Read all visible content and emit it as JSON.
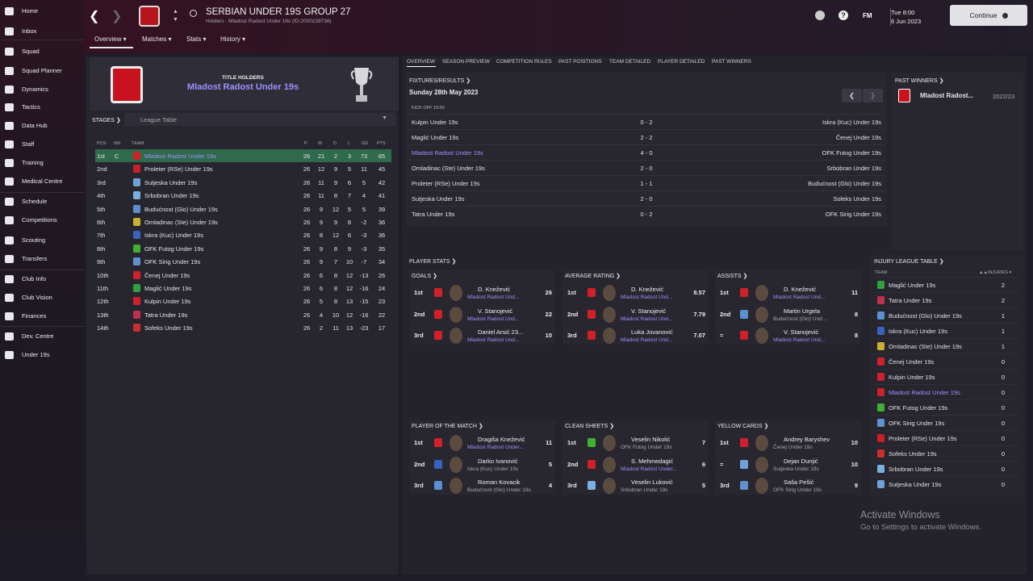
{
  "sidebar": [
    {
      "label": "Home",
      "icon": "home-icon"
    },
    {
      "label": "Inbox",
      "icon": "inbox-icon"
    },
    {
      "label": "Squad",
      "icon": "squad-icon"
    },
    {
      "label": "Squad Planner",
      "icon": "squad-planner-icon"
    },
    {
      "label": "Dynamics",
      "icon": "dynamics-icon"
    },
    {
      "label": "Tactics",
      "icon": "tactics-icon"
    },
    {
      "label": "Data Hub",
      "icon": "data-hub-icon"
    },
    {
      "label": "Staff",
      "icon": "staff-icon"
    },
    {
      "label": "Training",
      "icon": "training-icon"
    },
    {
      "label": "Medical Centre",
      "icon": "medical-icon"
    },
    {
      "label": "Schedule",
      "icon": "schedule-icon"
    },
    {
      "label": "Competitions",
      "icon": "competitions-icon"
    },
    {
      "label": "Scouting",
      "icon": "scouting-icon"
    },
    {
      "label": "Transfers",
      "icon": "transfers-icon"
    },
    {
      "label": "Club Info",
      "icon": "club-info-icon"
    },
    {
      "label": "Club Vision",
      "icon": "club-vision-icon"
    },
    {
      "label": "Finances",
      "icon": "finances-icon"
    },
    {
      "label": "Dev. Centre",
      "icon": "dev-centre-icon"
    },
    {
      "label": "Under 19s",
      "icon": "under-19s-icon"
    }
  ],
  "header": {
    "title": "SERBIAN UNDER 19S GROUP 27",
    "subtitle": "Holders - Mladost Radost Under 19s (ID:2000239736)",
    "date_day": "Tue 8:00",
    "date": "6 Jun 2023",
    "fm": "FM",
    "continue": "Continue"
  },
  "subtabs": [
    "Overview",
    "Matches",
    "Stats",
    "History"
  ],
  "holder": {
    "label": "TITLE HOLDERS",
    "name": "Mladost Radost Under 19s"
  },
  "stages": {
    "label": "STAGES",
    "value": "League Table"
  },
  "table_head": {
    "pos": "POS",
    "inf": "INF",
    "team": "TEAM",
    "p": "P",
    "w": "W",
    "d": "D",
    "l": "L",
    "gd": "GD",
    "pts": "PTS"
  },
  "league": [
    {
      "pos": "1st",
      "inf": "C",
      "team": "Mladost Radost Under 19s",
      "p": "26",
      "w": "21",
      "d": "2",
      "l": "3",
      "gd": "73",
      "pts": "65",
      "color": "#d0202a"
    },
    {
      "pos": "2nd",
      "inf": "",
      "team": "Proleter (RSe) Under 19s",
      "p": "26",
      "w": "12",
      "d": "9",
      "l": "5",
      "gd": "11",
      "pts": "45",
      "color": "#c8202a"
    },
    {
      "pos": "3rd",
      "inf": "",
      "team": "Sutjeska Under 19s",
      "p": "26",
      "w": "11",
      "d": "9",
      "l": "6",
      "gd": "5",
      "pts": "42",
      "color": "#6fa0d8"
    },
    {
      "pos": "4th",
      "inf": "",
      "team": "Srbobran Under 19s",
      "p": "26",
      "w": "11",
      "d": "8",
      "l": "7",
      "gd": "4",
      "pts": "41",
      "color": "#7ab0e0"
    },
    {
      "pos": "5th",
      "inf": "",
      "team": "Budućnost (Glo) Under 19s",
      "p": "26",
      "w": "9",
      "d": "12",
      "l": "5",
      "gd": "5",
      "pts": "39",
      "color": "#5a90d0"
    },
    {
      "pos": "6th",
      "inf": "",
      "team": "Omladinac (Ste) Under 19s",
      "p": "26",
      "w": "9",
      "d": "9",
      "l": "8",
      "gd": "-2",
      "pts": "36",
      "color": "#c8b030"
    },
    {
      "pos": "7th",
      "inf": "",
      "team": "Iskra (Kuc) Under 19s",
      "p": "26",
      "w": "8",
      "d": "12",
      "l": "6",
      "gd": "-3",
      "pts": "36",
      "color": "#3a60c0"
    },
    {
      "pos": "8th",
      "inf": "",
      "team": "OFK Futog Under 19s",
      "p": "26",
      "w": "9",
      "d": "8",
      "l": "9",
      "gd": "-3",
      "pts": "35",
      "color": "#40b030"
    },
    {
      "pos": "9th",
      "inf": "",
      "team": "OFK Sirig Under 19s",
      "p": "26",
      "w": "9",
      "d": "7",
      "l": "10",
      "gd": "-7",
      "pts": "34",
      "color": "#6090d0"
    },
    {
      "pos": "10th",
      "inf": "",
      "team": "Čenej Under 19s",
      "p": "26",
      "w": "6",
      "d": "8",
      "l": "12",
      "gd": "-13",
      "pts": "26",
      "color": "#d02030"
    },
    {
      "pos": "11th",
      "inf": "",
      "team": "Maglić Under 19s",
      "p": "26",
      "w": "6",
      "d": "8",
      "l": "12",
      "gd": "-16",
      "pts": "24",
      "color": "#30a040"
    },
    {
      "pos": "12th",
      "inf": "",
      "team": "Kulpin Under 19s",
      "p": "26",
      "w": "5",
      "d": "8",
      "l": "13",
      "gd": "-15",
      "pts": "23",
      "color": "#d02030"
    },
    {
      "pos": "13th",
      "inf": "",
      "team": "Tatra Under 19s",
      "p": "26",
      "w": "4",
      "d": "10",
      "l": "12",
      "gd": "-16",
      "pts": "22",
      "color": "#c03050"
    },
    {
      "pos": "14th",
      "inf": "",
      "team": "Sofeks Under 19s",
      "p": "26",
      "w": "2",
      "d": "11",
      "l": "13",
      "gd": "-23",
      "pts": "17",
      "color": "#c83030"
    }
  ],
  "right_tabs": [
    "OVERVIEW",
    "SEASON PREVIEW",
    "COMPETITION RULES",
    "PAST POSITIONS",
    "TEAM DETAILED",
    "PLAYER DETAILED",
    "PAST WINNERS"
  ],
  "fixtures": {
    "label": "FIXTURES/RESULTS",
    "date": "Sunday 28th May 2023",
    "kickoff": "KICK OFF 15:00",
    "rows": [
      {
        "home": "Kulpin Under 19s",
        "score": "0 - 2",
        "away": "Iskra (Kuc) Under 19s",
        "hl": false
      },
      {
        "home": "Maglić Under 19s",
        "score": "2 - 2",
        "away": "Čenej Under 19s",
        "hl": false
      },
      {
        "home": "Mladost Radost Under 19s",
        "score": "4 - 0",
        "away": "OFK Futog Under 19s",
        "hl": true
      },
      {
        "home": "Omladinac (Ste) Under 19s",
        "score": "2 - 0",
        "away": "Srbobran Under 19s",
        "hl": false
      },
      {
        "home": "Proleter (RSe) Under 19s",
        "score": "1 - 1",
        "away": "Budućnost (Glo) Under 19s",
        "hl": false
      },
      {
        "home": "Sutjeska Under 19s",
        "score": "2 - 0",
        "away": "Sofeks Under 19s",
        "hl": false
      },
      {
        "home": "Tatra Under 19s",
        "score": "0 - 2",
        "away": "OFK Sirig Under 19s",
        "hl": false
      }
    ]
  },
  "past_winners": {
    "label": "PAST WINNERS",
    "team": "Mladost Radost...",
    "season": "2022/23"
  },
  "player_stats": {
    "label": "PLAYER STATS",
    "groups": [
      {
        "title": "GOALS",
        "rows": [
          {
            "rank": "1st",
            "name": "D. Knežević",
            "team": "Mladost Radost Und...",
            "val": "26",
            "crest": "#d0202a",
            "hl": true
          },
          {
            "rank": "2nd",
            "name": "V. Stanojević",
            "team": "Mladost Radost Und...",
            "val": "22",
            "crest": "#d0202a",
            "hl": true
          },
          {
            "rank": "3rd",
            "name": "Daniel Arsić 23...",
            "team": "Mladost Radost Und...",
            "val": "10",
            "crest": "#d0202a",
            "hl": true
          }
        ]
      },
      {
        "title": "AVERAGE RATING",
        "rows": [
          {
            "rank": "1st",
            "name": "D. Knežević",
            "team": "Mladost Radost Und...",
            "val": "8.57",
            "crest": "#d0202a",
            "hl": true
          },
          {
            "rank": "2nd",
            "name": "V. Stanojević",
            "team": "Mladost Radost Und...",
            "val": "7.79",
            "crest": "#d0202a",
            "hl": true
          },
          {
            "rank": "3rd",
            "name": "Luka Jovanović",
            "team": "Mladost Radost Und...",
            "val": "7.07",
            "crest": "#d0202a",
            "hl": true
          }
        ]
      },
      {
        "title": "ASSISTS",
        "rows": [
          {
            "rank": "1st",
            "name": "D. Knežević",
            "team": "Mladost Radost Und...",
            "val": "11",
            "crest": "#d0202a",
            "hl": true
          },
          {
            "rank": "2nd",
            "name": "Martin Urgela",
            "team": "Budućnost (Glo) Und...",
            "val": "8",
            "crest": "#5a90d0",
            "hl": false
          },
          {
            "rank": "=",
            "name": "V. Stanojević",
            "team": "Mladost Radost Und...",
            "val": "8",
            "crest": "#d0202a",
            "hl": true
          }
        ]
      },
      {
        "title": "PLAYER OF THE MATCH",
        "rows": [
          {
            "rank": "1st",
            "name": "Dragiša Knežević",
            "team": "Mladost Radost Under...",
            "val": "11",
            "crest": "#d0202a",
            "hl": true
          },
          {
            "rank": "2nd",
            "name": "Darko Ivanović",
            "team": "Iskra (Kuc) Under 19s",
            "val": "5",
            "crest": "#3a60c0",
            "hl": false
          },
          {
            "rank": "3rd",
            "name": "Roman Kovacik",
            "team": "Budućnost (Glo) Under 19s",
            "val": "4",
            "crest": "#5a90d0",
            "hl": false
          }
        ]
      },
      {
        "title": "CLEAN SHEETS",
        "rows": [
          {
            "rank": "1st",
            "name": "Veselin Nikolić",
            "team": "OFK Futog Under 19s",
            "val": "7",
            "crest": "#40b030",
            "hl": false
          },
          {
            "rank": "2nd",
            "name": "S. Mehmedagić",
            "team": "Mladost Radost Under...",
            "val": "6",
            "crest": "#d0202a",
            "hl": true
          },
          {
            "rank": "3rd",
            "name": "Veselin Luković",
            "team": "Srbobran Under 19s",
            "val": "5",
            "crest": "#7ab0e0",
            "hl": false
          }
        ]
      },
      {
        "title": "YELLOW CARDS",
        "rows": [
          {
            "rank": "1st",
            "name": "Andrey Baryshev",
            "team": "Čenej Under 19s",
            "val": "10",
            "crest": "#d02030",
            "hl": false
          },
          {
            "rank": "=",
            "name": "Dejan Dunjić",
            "team": "Sutjeska Under 19s",
            "val": "10",
            "crest": "#6fa0d8",
            "hl": false
          },
          {
            "rank": "3rd",
            "name": "Saša Pešić",
            "team": "OFK Sirig Under 19s",
            "val": "9",
            "crest": "#6090d0",
            "hl": false
          }
        ]
      }
    ]
  },
  "injury": {
    "label": "INJURY LEAGUE TABLE",
    "col_team": "TEAM",
    "col_inj": "INJURIES",
    "rows": [
      {
        "team": "Maglić Under 19s",
        "val": "2",
        "crest": "#30a040",
        "hl": false
      },
      {
        "team": "Tatra Under 19s",
        "val": "2",
        "crest": "#c03050",
        "hl": false
      },
      {
        "team": "Budućnost (Glo) Under 19s",
        "val": "1",
        "crest": "#5a90d0",
        "hl": false
      },
      {
        "team": "Iskra (Kuc) Under 19s",
        "val": "1",
        "crest": "#3a60c0",
        "hl": false
      },
      {
        "team": "Omladinac (Ste) Under 19s",
        "val": "1",
        "crest": "#c8b030",
        "hl": false
      },
      {
        "team": "Čenej Under 19s",
        "val": "0",
        "crest": "#d02030",
        "hl": false
      },
      {
        "team": "Kulpin Under 19s",
        "val": "0",
        "crest": "#d02030",
        "hl": false
      },
      {
        "team": "Mladost Radost Under 19s",
        "val": "0",
        "crest": "#d0202a",
        "hl": true
      },
      {
        "team": "OFK Futog Under 19s",
        "val": "0",
        "crest": "#40b030",
        "hl": false
      },
      {
        "team": "OFK Sirig Under 19s",
        "val": "0",
        "crest": "#6090d0",
        "hl": false
      },
      {
        "team": "Proleter (RSe) Under 19s",
        "val": "0",
        "crest": "#c8202a",
        "hl": false
      },
      {
        "team": "Sofeks Under 19s",
        "val": "0",
        "crest": "#c83030",
        "hl": false
      },
      {
        "team": "Srbobran Under 19s",
        "val": "0",
        "crest": "#7ab0e0",
        "hl": false
      },
      {
        "team": "Sutjeska Under 19s",
        "val": "0",
        "crest": "#6fa0d8",
        "hl": false
      }
    ]
  },
  "watermark": {
    "line1": "Activate Windows",
    "line2": "Go to Settings to activate Windows."
  },
  "colors": {
    "highlight_text": "#9c91ff",
    "selected_row": "#2f6a4c",
    "brand_red": "#c8131e"
  }
}
